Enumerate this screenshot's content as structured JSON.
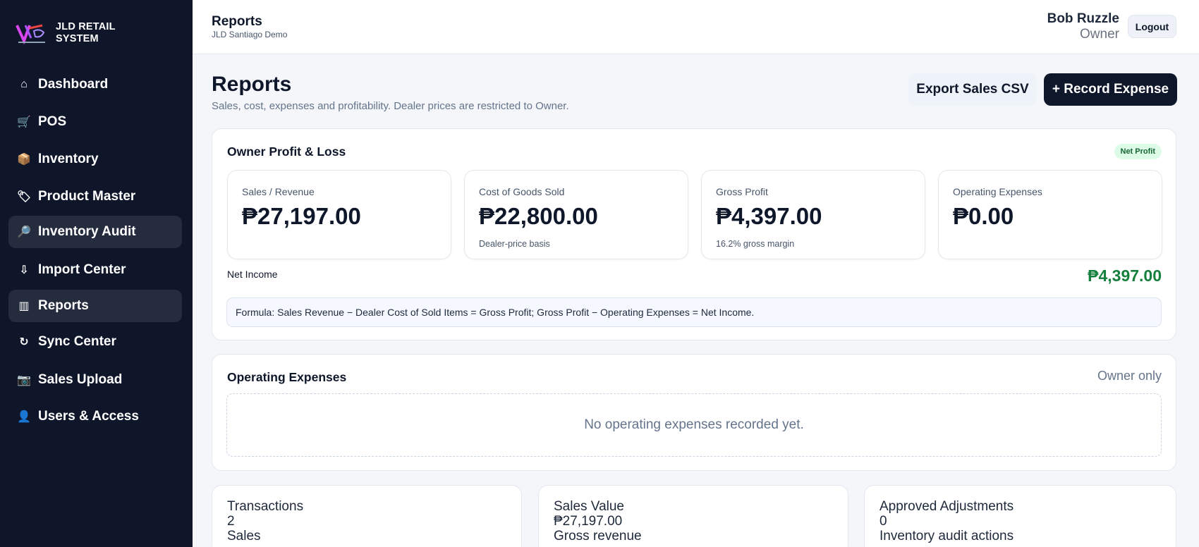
{
  "brand": {
    "name_line1": "JLD RETAIL",
    "name_line2": "SYSTEM"
  },
  "sidebar": {
    "items": [
      {
        "icon": "home-icon",
        "glyph": "⌂",
        "label": "Dashboard",
        "active": false
      },
      {
        "icon": "cart-icon",
        "glyph": "🛒",
        "label": "POS",
        "active": false
      },
      {
        "icon": "package-icon",
        "glyph": "📦",
        "label": "Inventory",
        "active": false
      },
      {
        "icon": "tag-icon",
        "glyph": "🏷",
        "label": "Product Master",
        "active": false
      },
      {
        "icon": "magnifier-icon",
        "glyph": "🔎",
        "label": "Inventory Audit",
        "active": true
      },
      {
        "icon": "download-arrow-icon",
        "glyph": "⇩",
        "label": "Import Center",
        "active": false
      },
      {
        "icon": "bar-chart-icon",
        "glyph": "▥",
        "label": "Reports",
        "active": true
      },
      {
        "icon": "refresh-icon",
        "glyph": "↻",
        "label": "Sync Center",
        "active": false
      },
      {
        "icon": "camera-icon",
        "glyph": "📷",
        "label": "Sales Upload",
        "active": false
      },
      {
        "icon": "user-icon",
        "glyph": "👤",
        "label": "Users & Access",
        "active": false
      }
    ]
  },
  "header": {
    "title": "Reports",
    "subtitle": "JLD Santiago Demo",
    "user_name": "Bob Ruzzle",
    "user_role": "Owner",
    "logout_label": "Logout"
  },
  "page": {
    "title": "Reports",
    "subtitle": "Sales, cost, expenses and profitability. Dealer prices are restricted to Owner.",
    "export_label": "Export Sales CSV",
    "record_label": "+ Record Expense"
  },
  "pnl": {
    "title": "Owner Profit & Loss",
    "badge": "Net Profit",
    "metrics": [
      {
        "label": "Sales / Revenue",
        "value": "₱27,197.00",
        "note": ""
      },
      {
        "label": "Cost of Goods Sold",
        "value": "₱22,800.00",
        "note": "Dealer-price basis"
      },
      {
        "label": "Gross Profit",
        "value": "₱4,397.00",
        "note": "16.2% gross margin"
      },
      {
        "label": "Operating Expenses",
        "value": "₱0.00",
        "note": ""
      }
    ],
    "net_income_label": "Net Income",
    "net_income_value": "₱4,397.00",
    "formula": "Formula: Sales Revenue − Dealer Cost of Sold Items = Gross Profit; Gross Profit − Operating Expenses = Net Income."
  },
  "expenses": {
    "title": "Operating Expenses",
    "scope": "Owner only",
    "empty_text": "No operating expenses recorded yet."
  },
  "stats": [
    {
      "label": "Transactions",
      "value": "2",
      "caption": "Sales"
    },
    {
      "label": "Sales Value",
      "value": "₱27,197.00",
      "caption": "Gross revenue"
    },
    {
      "label": "Approved Adjustments",
      "value": "0",
      "caption": "Inventory audit actions"
    }
  ],
  "colors": {
    "sidebar_bg": "#0f1629",
    "accent_dark": "#0f172a",
    "profit_green": "#15803d",
    "badge_green_bg": "#dcfce7"
  }
}
